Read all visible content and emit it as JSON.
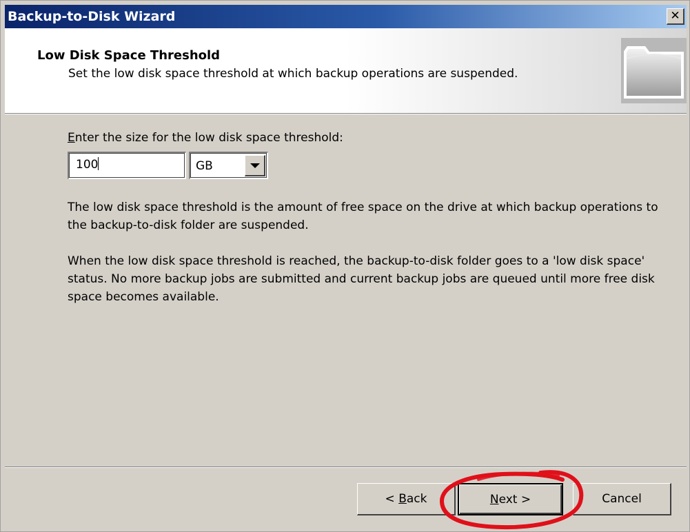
{
  "window": {
    "title": "Backup-to-Disk Wizard",
    "close_glyph": "✕"
  },
  "header": {
    "title": "Low Disk Space Threshold",
    "subtitle": "Set the low disk space threshold at which backup operations are suspended.",
    "icon": "folder-icon"
  },
  "form": {
    "prompt_accel": "E",
    "prompt_rest": "nter the size for the low disk space threshold:",
    "size_value": "100",
    "unit_selected": "GB"
  },
  "description": {
    "paragraph1": "The low disk space threshold is the amount of free space on the drive at which backup operations to the backup-to-disk folder are suspended.",
    "paragraph2": "When the low disk space threshold is reached, the backup-to-disk folder goes to a 'low disk space' status.  No more backup jobs are submitted and current backup jobs are queued until more free disk space becomes available."
  },
  "buttons": {
    "back_prefix": "< ",
    "back_accel": "B",
    "back_rest": "ack",
    "next_accel": "N",
    "next_rest": "ext >",
    "cancel": "Cancel"
  },
  "colors": {
    "titlebar_start": "#0a246a",
    "titlebar_end": "#a6caf0",
    "dialog_face": "#d4d0c8",
    "highlight_ring": "#e0101a"
  }
}
